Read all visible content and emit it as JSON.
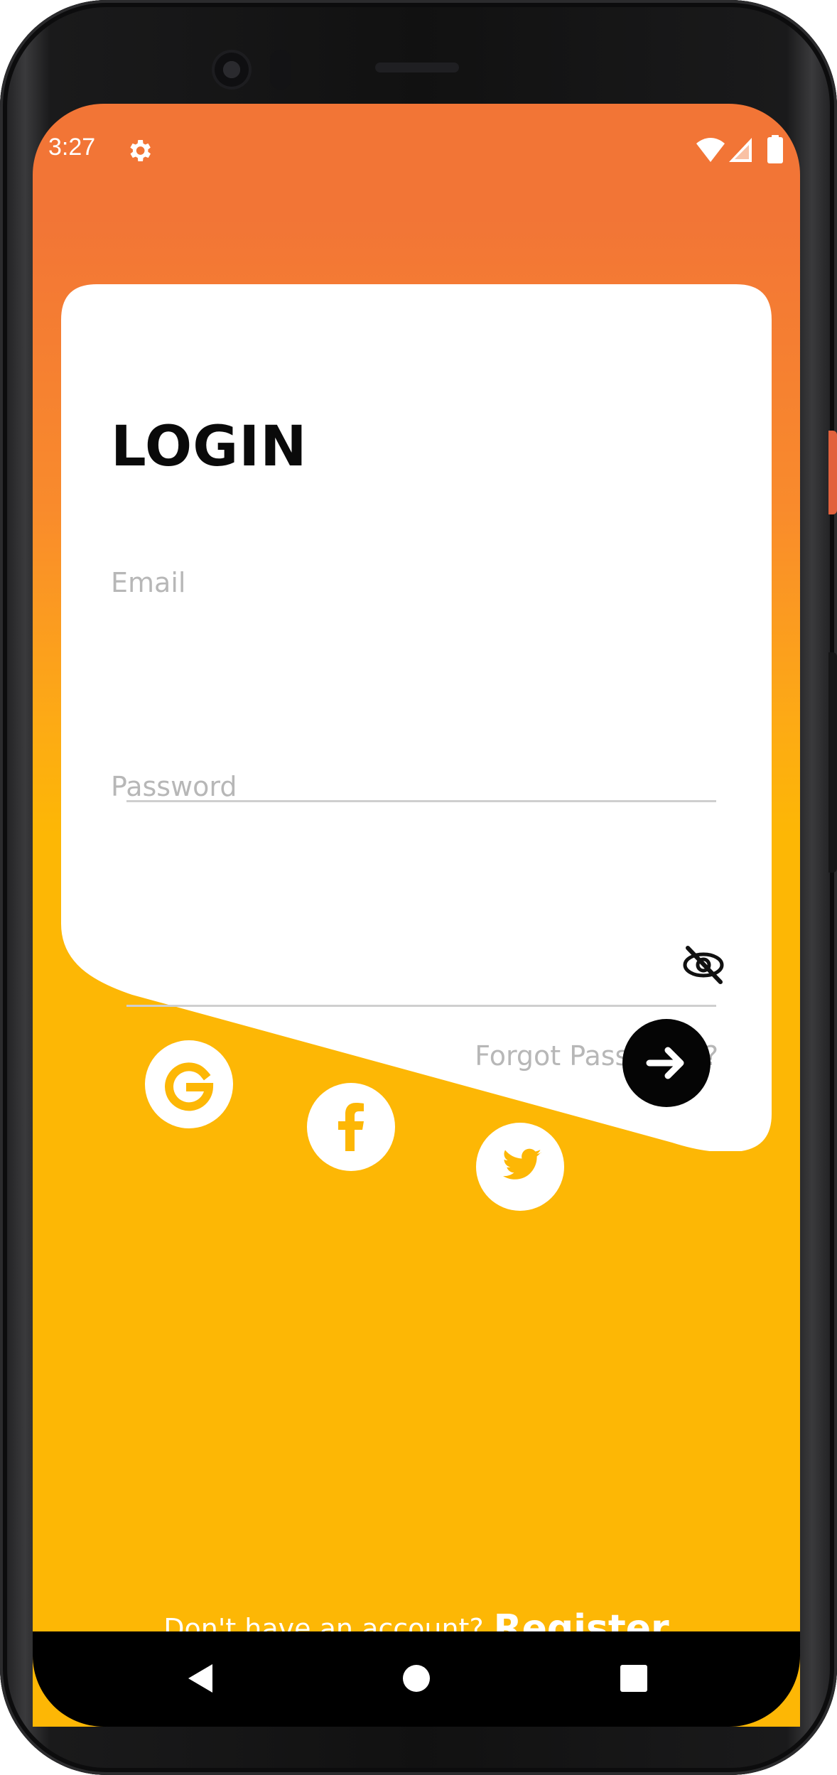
{
  "status_bar": {
    "time": "3:27",
    "icons": [
      "settings-icon",
      "wifi-icon",
      "signal-icon",
      "battery-icon"
    ]
  },
  "login": {
    "title": "LOGIN",
    "email_label": "Email",
    "email_value": "",
    "password_label": "Password",
    "password_value": "",
    "forgot_password": "Forgot Password ?",
    "submit_icon": "arrow-right-icon"
  },
  "social": {
    "providers": [
      "google",
      "facebook",
      "twitter"
    ]
  },
  "footer": {
    "prompt": "Don't have an account?",
    "link": "Register"
  },
  "nav": {
    "buttons": [
      "back",
      "home",
      "recents"
    ]
  },
  "colors": {
    "gradient_top": "#f27536",
    "gradient_bottom": "#fdb705",
    "card": "#ffffff",
    "title": "#0a0a0a",
    "label": "#b7b7b7",
    "submit_button": "#050505",
    "navbar": "#000000"
  }
}
